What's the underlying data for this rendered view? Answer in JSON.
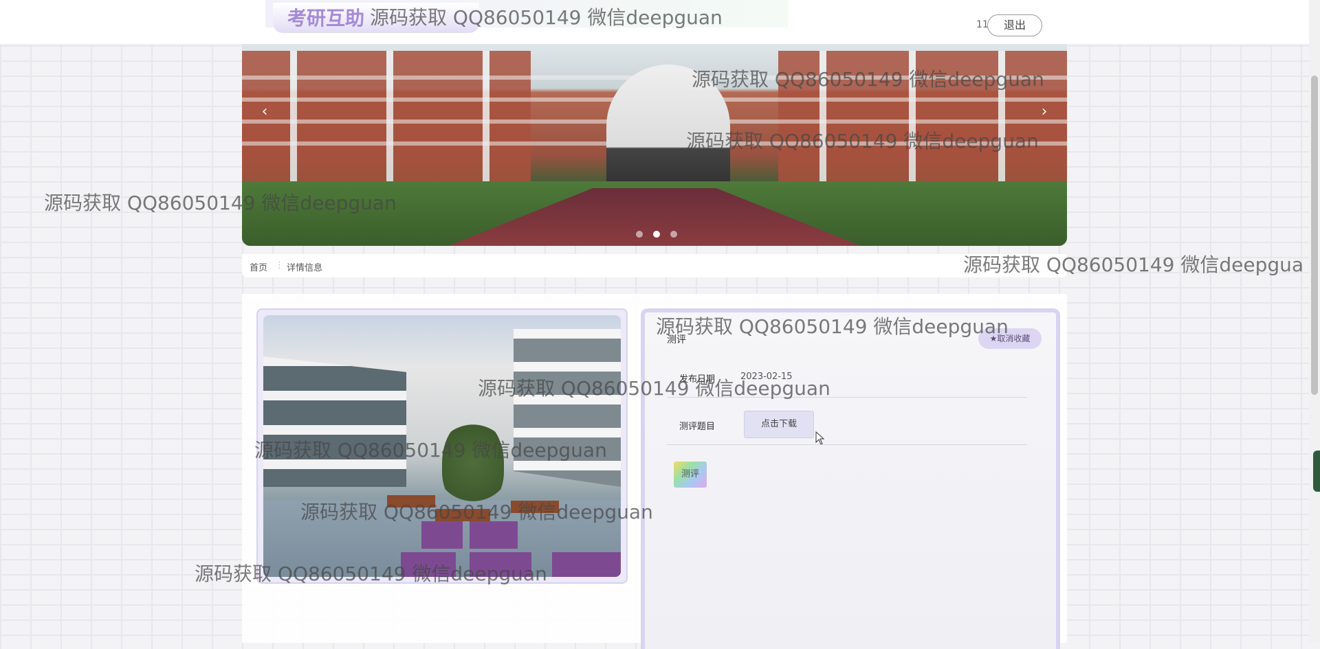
{
  "header": {
    "brand_title": "考研互助",
    "user_name": "11",
    "logout_label": "退出"
  },
  "carousel": {
    "prev_label": "‹",
    "next_label": "›",
    "slide_count": 3,
    "active_index": 1
  },
  "breadcrumb": {
    "home": "首页",
    "separator": "⋮",
    "current": "详情信息"
  },
  "detail": {
    "title": "测评",
    "favorite_label": "★取消收藏",
    "publish_date_label": "发布日期",
    "publish_date_value": "2023-02-15",
    "topic_label": "测评题目",
    "download_label": "点击下载",
    "evaluate_label": "测评"
  },
  "watermarks": [
    "源码获取 QQ86050149 微信deepguan",
    "源码获取 QQ86050149 微信deepguan",
    "源码获取 QQ86050149 微信deepguan",
    "源码获取 QQ86050149 微信deepguan",
    "源码获取 QQ86050149 微信deepguan",
    "源码获取 QQ86050149 微信deepguan",
    "源码获取 QQ86050149 微信deepguan",
    "源码获取 QQ86050149 微信deepguan",
    "源码获取 QQ86050149 微信deepguan",
    "源码获取 QQ86050149 微信deepgua"
  ],
  "colors": {
    "brand": "#a48ad8",
    "card_border": "#d9d3f2",
    "button_bg": "#e2e0f3"
  },
  "icons": [
    "chevron-left-icon",
    "chevron-right-icon",
    "star-icon",
    "mouse-cursor-icon"
  ]
}
